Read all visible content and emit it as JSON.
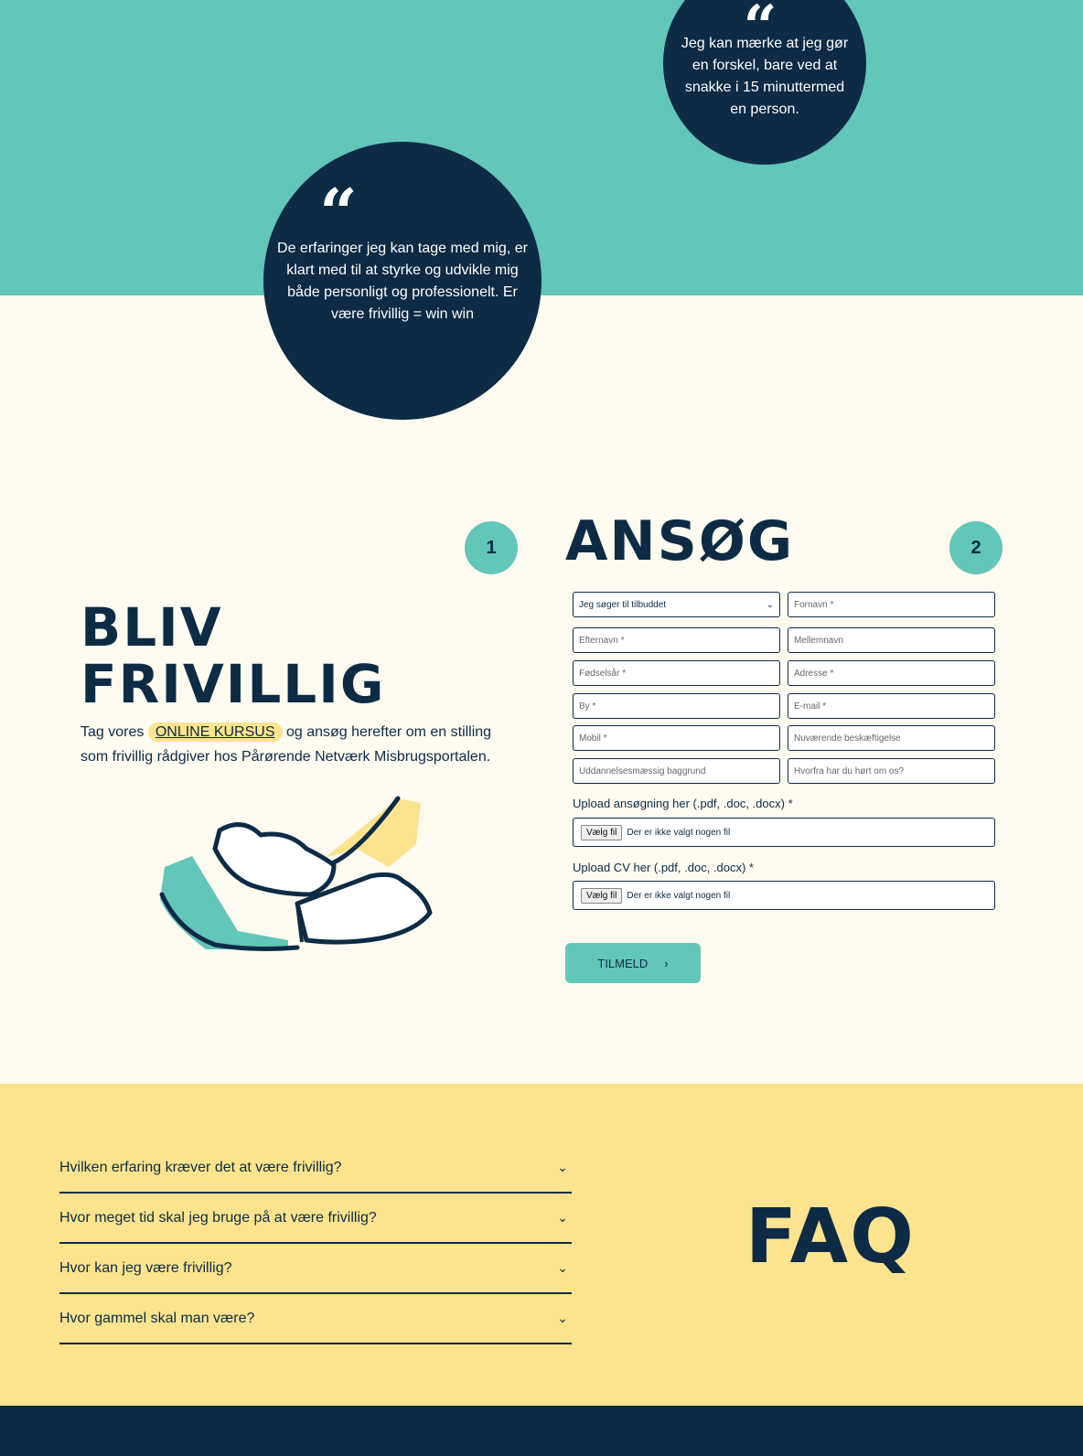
{
  "colors": {
    "teal": "#62c6b9",
    "navy": "#0d2b45",
    "cream": "#fdfaf0",
    "yellow": "#fce38d"
  },
  "quotes": [
    {
      "mark": "“",
      "text": "Jeg kan mærke at jeg gør en forskel, bare ved at snakke i 15 minuttermed en person."
    },
    {
      "mark": "“",
      "text": "De erfaringer jeg kan tage med mig, er klart med til at styrke og udvikle mig både personligt og professionelt. Er være frivillig = win win"
    }
  ],
  "steps": {
    "one": "1",
    "two": "2"
  },
  "signup": {
    "heading_line1": "BLIV",
    "heading_line2": "FRIVILLIG",
    "intro_before": "Tag vores ",
    "intro_link": "ONLINE KURSUS",
    "intro_after": " og ansøg herefter om en stilling som frivillig rådgiver hos Pårørende Netværk Misbrugsportalen."
  },
  "form": {
    "heading": "ANSØG",
    "select_value": "Jeg søger til tilbuddet",
    "fields": {
      "fornavn": "Fornavn *",
      "efternavn": "Efternavn *",
      "mellemnavn": "Mellemnavn",
      "fodselsar": "Fødselsår *",
      "adresse": "Adresse *",
      "by": "By *",
      "email": "E-mail *",
      "mobil": "Mobil *",
      "beskaeftigelse": "Nuværende beskæftigelse",
      "uddannelse": "Uddannelsesmæssig baggrund",
      "hvorfra": "Hvorfra har du hørt om os?"
    },
    "upload_application_label": "Upload ansøgning her (.pdf, .doc, .docx) *",
    "upload_cv_label": "Upload CV her (.pdf, .doc, .docx) *",
    "file_button": "Vælg fil",
    "no_file": "Der er ikke valgt nogen fil",
    "submit": "TILMELD"
  },
  "faq": {
    "heading": "FAQ",
    "items": [
      "Hvilken erfaring kræver det at være frivillig?",
      "Hvor meget tid skal jeg bruge på at være frivillig?",
      "Hvor kan jeg være frivillig?",
      "Hvor gammel skal man være?"
    ]
  },
  "icons": {
    "chevron_down": "chevron-down-icon",
    "chevron_right": "chevron-right-icon"
  }
}
